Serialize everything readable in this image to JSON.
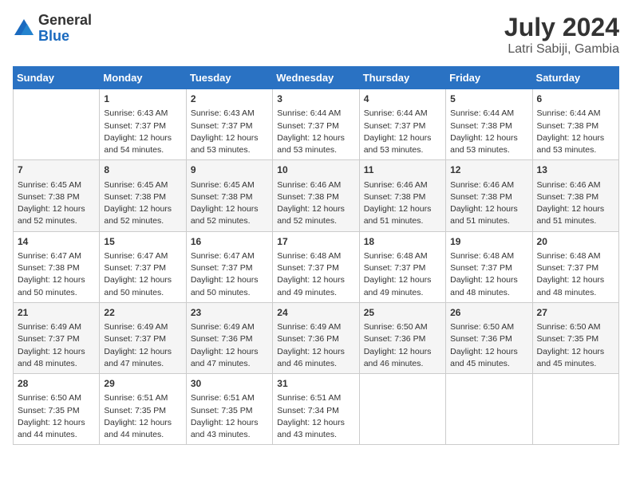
{
  "header": {
    "logo": {
      "general": "General",
      "blue": "Blue"
    },
    "month_year": "July 2024",
    "location": "Latri Sabiji, Gambia"
  },
  "days_of_week": [
    "Sunday",
    "Monday",
    "Tuesday",
    "Wednesday",
    "Thursday",
    "Friday",
    "Saturday"
  ],
  "weeks": [
    [
      {
        "day": "",
        "sunrise": "",
        "sunset": "",
        "daylight": ""
      },
      {
        "day": "1",
        "sunrise": "Sunrise: 6:43 AM",
        "sunset": "Sunset: 7:37 PM",
        "daylight": "Daylight: 12 hours and 54 minutes."
      },
      {
        "day": "2",
        "sunrise": "Sunrise: 6:43 AM",
        "sunset": "Sunset: 7:37 PM",
        "daylight": "Daylight: 12 hours and 53 minutes."
      },
      {
        "day": "3",
        "sunrise": "Sunrise: 6:44 AM",
        "sunset": "Sunset: 7:37 PM",
        "daylight": "Daylight: 12 hours and 53 minutes."
      },
      {
        "day": "4",
        "sunrise": "Sunrise: 6:44 AM",
        "sunset": "Sunset: 7:37 PM",
        "daylight": "Daylight: 12 hours and 53 minutes."
      },
      {
        "day": "5",
        "sunrise": "Sunrise: 6:44 AM",
        "sunset": "Sunset: 7:38 PM",
        "daylight": "Daylight: 12 hours and 53 minutes."
      },
      {
        "day": "6",
        "sunrise": "Sunrise: 6:44 AM",
        "sunset": "Sunset: 7:38 PM",
        "daylight": "Daylight: 12 hours and 53 minutes."
      }
    ],
    [
      {
        "day": "7",
        "sunrise": "Sunrise: 6:45 AM",
        "sunset": "Sunset: 7:38 PM",
        "daylight": "Daylight: 12 hours and 52 minutes."
      },
      {
        "day": "8",
        "sunrise": "Sunrise: 6:45 AM",
        "sunset": "Sunset: 7:38 PM",
        "daylight": "Daylight: 12 hours and 52 minutes."
      },
      {
        "day": "9",
        "sunrise": "Sunrise: 6:45 AM",
        "sunset": "Sunset: 7:38 PM",
        "daylight": "Daylight: 12 hours and 52 minutes."
      },
      {
        "day": "10",
        "sunrise": "Sunrise: 6:46 AM",
        "sunset": "Sunset: 7:38 PM",
        "daylight": "Daylight: 12 hours and 52 minutes."
      },
      {
        "day": "11",
        "sunrise": "Sunrise: 6:46 AM",
        "sunset": "Sunset: 7:38 PM",
        "daylight": "Daylight: 12 hours and 51 minutes."
      },
      {
        "day": "12",
        "sunrise": "Sunrise: 6:46 AM",
        "sunset": "Sunset: 7:38 PM",
        "daylight": "Daylight: 12 hours and 51 minutes."
      },
      {
        "day": "13",
        "sunrise": "Sunrise: 6:46 AM",
        "sunset": "Sunset: 7:38 PM",
        "daylight": "Daylight: 12 hours and 51 minutes."
      }
    ],
    [
      {
        "day": "14",
        "sunrise": "Sunrise: 6:47 AM",
        "sunset": "Sunset: 7:38 PM",
        "daylight": "Daylight: 12 hours and 50 minutes."
      },
      {
        "day": "15",
        "sunrise": "Sunrise: 6:47 AM",
        "sunset": "Sunset: 7:37 PM",
        "daylight": "Daylight: 12 hours and 50 minutes."
      },
      {
        "day": "16",
        "sunrise": "Sunrise: 6:47 AM",
        "sunset": "Sunset: 7:37 PM",
        "daylight": "Daylight: 12 hours and 50 minutes."
      },
      {
        "day": "17",
        "sunrise": "Sunrise: 6:48 AM",
        "sunset": "Sunset: 7:37 PM",
        "daylight": "Daylight: 12 hours and 49 minutes."
      },
      {
        "day": "18",
        "sunrise": "Sunrise: 6:48 AM",
        "sunset": "Sunset: 7:37 PM",
        "daylight": "Daylight: 12 hours and 49 minutes."
      },
      {
        "day": "19",
        "sunrise": "Sunrise: 6:48 AM",
        "sunset": "Sunset: 7:37 PM",
        "daylight": "Daylight: 12 hours and 48 minutes."
      },
      {
        "day": "20",
        "sunrise": "Sunrise: 6:48 AM",
        "sunset": "Sunset: 7:37 PM",
        "daylight": "Daylight: 12 hours and 48 minutes."
      }
    ],
    [
      {
        "day": "21",
        "sunrise": "Sunrise: 6:49 AM",
        "sunset": "Sunset: 7:37 PM",
        "daylight": "Daylight: 12 hours and 48 minutes."
      },
      {
        "day": "22",
        "sunrise": "Sunrise: 6:49 AM",
        "sunset": "Sunset: 7:37 PM",
        "daylight": "Daylight: 12 hours and 47 minutes."
      },
      {
        "day": "23",
        "sunrise": "Sunrise: 6:49 AM",
        "sunset": "Sunset: 7:36 PM",
        "daylight": "Daylight: 12 hours and 47 minutes."
      },
      {
        "day": "24",
        "sunrise": "Sunrise: 6:49 AM",
        "sunset": "Sunset: 7:36 PM",
        "daylight": "Daylight: 12 hours and 46 minutes."
      },
      {
        "day": "25",
        "sunrise": "Sunrise: 6:50 AM",
        "sunset": "Sunset: 7:36 PM",
        "daylight": "Daylight: 12 hours and 46 minutes."
      },
      {
        "day": "26",
        "sunrise": "Sunrise: 6:50 AM",
        "sunset": "Sunset: 7:36 PM",
        "daylight": "Daylight: 12 hours and 45 minutes."
      },
      {
        "day": "27",
        "sunrise": "Sunrise: 6:50 AM",
        "sunset": "Sunset: 7:35 PM",
        "daylight": "Daylight: 12 hours and 45 minutes."
      }
    ],
    [
      {
        "day": "28",
        "sunrise": "Sunrise: 6:50 AM",
        "sunset": "Sunset: 7:35 PM",
        "daylight": "Daylight: 12 hours and 44 minutes."
      },
      {
        "day": "29",
        "sunrise": "Sunrise: 6:51 AM",
        "sunset": "Sunset: 7:35 PM",
        "daylight": "Daylight: 12 hours and 44 minutes."
      },
      {
        "day": "30",
        "sunrise": "Sunrise: 6:51 AM",
        "sunset": "Sunset: 7:35 PM",
        "daylight": "Daylight: 12 hours and 43 minutes."
      },
      {
        "day": "31",
        "sunrise": "Sunrise: 6:51 AM",
        "sunset": "Sunset: 7:34 PM",
        "daylight": "Daylight: 12 hours and 43 minutes."
      },
      {
        "day": "",
        "sunrise": "",
        "sunset": "",
        "daylight": ""
      },
      {
        "day": "",
        "sunrise": "",
        "sunset": "",
        "daylight": ""
      },
      {
        "day": "",
        "sunrise": "",
        "sunset": "",
        "daylight": ""
      }
    ]
  ]
}
